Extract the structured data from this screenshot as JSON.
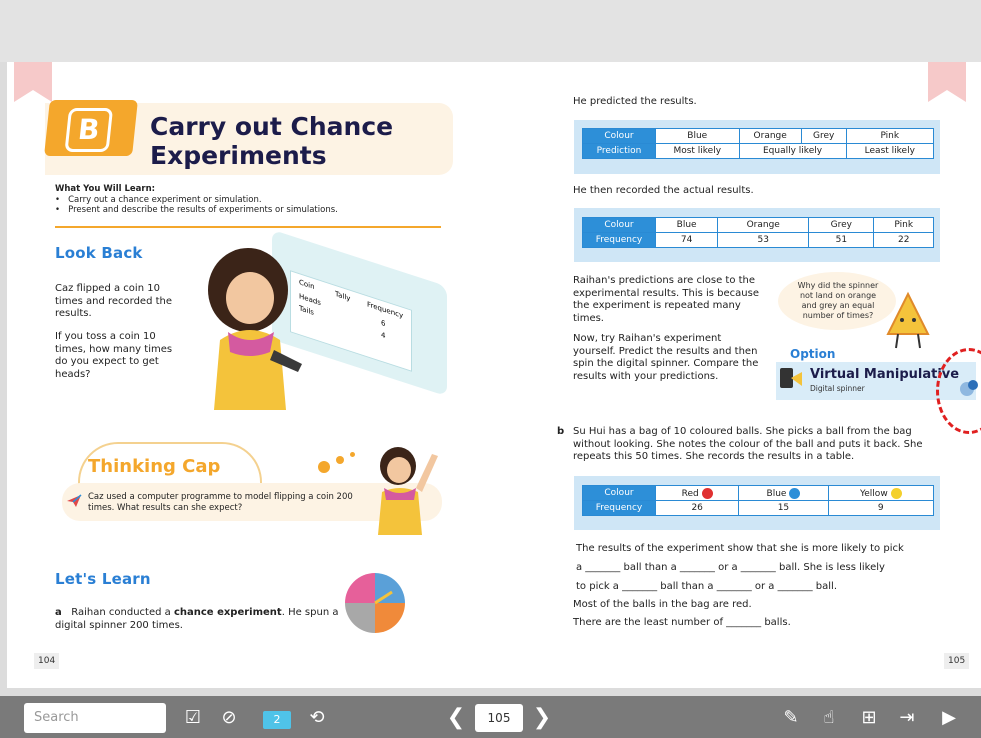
{
  "left_page": {
    "header_badge": "B",
    "title_line1": "Carry out Chance",
    "title_line2": "Experiments",
    "learn_heading": "What You Will Learn:",
    "learn_items": [
      "Carry out a chance experiment or simulation.",
      "Present and describe the results of experiments or simulations."
    ],
    "look_back_title": "Look Back",
    "look_back_text1": "Caz flipped a coin 10 times and recorded the results.",
    "look_back_text2": "If you toss a coin 10 times, how many times do you expect to get heads?",
    "tally_labels": {
      "coin": "Coin",
      "tally": "Tally",
      "frequency": "Frequency",
      "heads": "Heads",
      "tails": "Tails",
      "heads_val": "6",
      "tails_val": "4"
    },
    "thinking_cap_title": "Thinking Cap",
    "thinking_cap_text": "Caz used a computer programme to model flipping a coin 200 times. What results can she expect?",
    "lets_learn_title": "Let's Learn",
    "item_a_label": "a",
    "item_a_text_pre": "Raihan conducted a ",
    "item_a_bold": "chance experiment",
    "item_a_text_post": ". He spun a digital spinner 200 times.",
    "page_number": "104"
  },
  "right_page": {
    "predicted_text": "He predicted the results.",
    "prediction_table": {
      "row1_label": "Colour",
      "row1": [
        "Blue",
        "Orange",
        "Grey",
        "Pink"
      ],
      "row2_label": "Prediction",
      "row2": [
        "Most likely",
        "Equally likely",
        "Least likely"
      ]
    },
    "recorded_text": "He then recorded the actual results.",
    "frequency_table": {
      "row1_label": "Colour",
      "row1": [
        "Blue",
        "Orange",
        "Grey",
        "Pink"
      ],
      "row2_label": "Frequency",
      "row2": [
        "74",
        "53",
        "51",
        "22"
      ]
    },
    "para1": "Raihan's predictions are close to the experimental results. This is because the experiment is repeated many times.",
    "para2": "Now, try Raihan's experiment yourself. Predict the results and then spin the digital spinner. Compare the results with your predictions.",
    "bubble_text": "Why did the spinner not land on orange and grey an equal number of times?",
    "option_label": "Option",
    "vm_title": "Virtual Manipulative",
    "vm_sub": "Digital spinner",
    "item_b_label": "b",
    "item_b_text": "Su Hui has a bag of 10 coloured balls. She picks a ball from the bag without looking. She notes the colour of the ball and puts it back. She repeats this 50 times. She records the results in a table.",
    "ball_table": {
      "row1_label": "Colour",
      "row1": [
        "Red",
        "Blue",
        "Yellow"
      ],
      "row2_label": "Frequency",
      "row2": [
        "26",
        "15",
        "9"
      ]
    },
    "fill1": "The results of the experiment show that she is more likely to pick",
    "fill2": "a _______ ball than a _______ or a _______ ball. She is less likely",
    "fill3": "to pick a _______ ball than a _______ or a _______ ball.",
    "fill4": "Most of the balls in the bag are red.",
    "fill5": "There are the least number of _______ balls.",
    "page_number": "105"
  },
  "toolbar": {
    "search_placeholder": "Search",
    "page_value": "105",
    "badge_number": "2",
    "icons": [
      "checkmark-doc-icon",
      "hide-icon",
      "bookmark-icon",
      "rotate-icon",
      "prev-page-icon",
      "next-page-icon",
      "pen-icon",
      "pointer-icon",
      "grid-icon",
      "exit-icon",
      "play-icon"
    ]
  },
  "colors": {
    "accent_orange": "#f4a72c",
    "accent_blue": "#2d8fd8",
    "title_navy": "#1c1c4a",
    "toolbar": "#7a7a7a"
  }
}
